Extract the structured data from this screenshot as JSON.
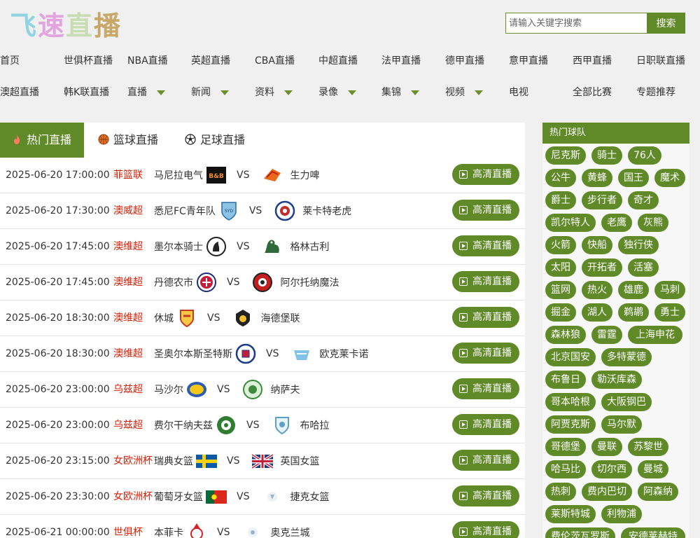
{
  "logo": {
    "chars": [
      "飞",
      "速",
      "直",
      "播"
    ]
  },
  "search": {
    "placeholder": "请输入关键字搜索",
    "button": "搜索"
  },
  "nav": {
    "row1": [
      "首页",
      "世俱杯直播",
      "NBA直播",
      "英超直播",
      "CBA直播",
      "中超直播",
      "法甲直播",
      "德甲直播",
      "意甲直播",
      "西甲直播",
      "日职联直播"
    ],
    "row2": [
      "澳超直播",
      "韩K联直播",
      "直播",
      "新闻",
      "资料",
      "录像",
      "集锦",
      "视频",
      "电视",
      "全部比赛",
      "专题推荐"
    ]
  },
  "tabs": [
    "热门直播",
    "篮球直播",
    "足球直播"
  ],
  "live_button": "高清直播",
  "matches": [
    {
      "time": "2025-06-20 17:00:00",
      "league": "菲篮联",
      "home": "马尼拉电气",
      "vs": "VS",
      "away": "生力啤"
    },
    {
      "time": "2025-06-20 17:30:00",
      "league": "澳威超",
      "home": "悉尼FC青年队",
      "vs": "VS",
      "away": "莱卡特老虎"
    },
    {
      "time": "2025-06-20 17:45:00",
      "league": "澳维超",
      "home": "墨尔本骑士",
      "vs": "VS",
      "away": "格林古利"
    },
    {
      "time": "2025-06-20 17:45:00",
      "league": "澳维超",
      "home": "丹德农市",
      "vs": "VS",
      "away": "阿尔托纳魔法"
    },
    {
      "time": "2025-06-20 18:30:00",
      "league": "澳维超",
      "home": "休城",
      "vs": "VS",
      "away": "海德堡联"
    },
    {
      "time": "2025-06-20 18:30:00",
      "league": "澳维超",
      "home": "圣奥尔本斯圣特斯",
      "vs": "VS",
      "away": "欧克莱卡诺"
    },
    {
      "time": "2025-06-20 23:00:00",
      "league": "乌兹超",
      "home": "马沙尔",
      "vs": "VS",
      "away": "纳萨夫"
    },
    {
      "time": "2025-06-20 23:00:00",
      "league": "乌兹超",
      "home": "费尔干纳夫兹",
      "vs": "VS",
      "away": "布哈拉"
    },
    {
      "time": "2025-06-20 23:15:00",
      "league": "女欧洲杯",
      "home": "瑞典女篮",
      "vs": "VS",
      "away": "英国女篮"
    },
    {
      "time": "2025-06-20 23:30:00",
      "league": "女欧洲杯",
      "home": "葡萄牙女篮",
      "vs": "VS",
      "away": "捷克女篮"
    },
    {
      "time": "2025-06-21 00:00:00",
      "league": "世俱杯",
      "home": "本菲卡",
      "vs": "VS",
      "away": "奥克兰城"
    }
  ],
  "sidebar": {
    "title": "热门球队",
    "teams": [
      "尼克斯",
      "骑士",
      "76人",
      "公牛",
      "黄蜂",
      "国王",
      "魔术",
      "爵士",
      "步行者",
      "奇才",
      "凯尔特人",
      "老鹰",
      "灰熊",
      "火箭",
      "快船",
      "独行侠",
      "太阳",
      "开拓者",
      "活塞",
      "篮网",
      "热火",
      "雄鹿",
      "马刺",
      "掘金",
      "湖人",
      "鹈鹕",
      "勇士",
      "森林狼",
      "雷霆",
      "上海申花",
      "北京国安",
      "多特蒙德",
      "布鲁日",
      "勒沃库森",
      "哥本哈根",
      "大阪钢巴",
      "阿贾克斯",
      "马尔默",
      "哥德堡",
      "曼联",
      "苏黎世",
      "哈马比",
      "切尔西",
      "曼城",
      "热刺",
      "费内巴切",
      "阿森纳",
      "莱斯特城",
      "利物浦",
      "费伦茨瓦罗斯",
      "安德莱赫特"
    ]
  },
  "colors": {
    "accent": "#5f8a27",
    "league": "#d81e06",
    "background": "#f0f0f0"
  }
}
